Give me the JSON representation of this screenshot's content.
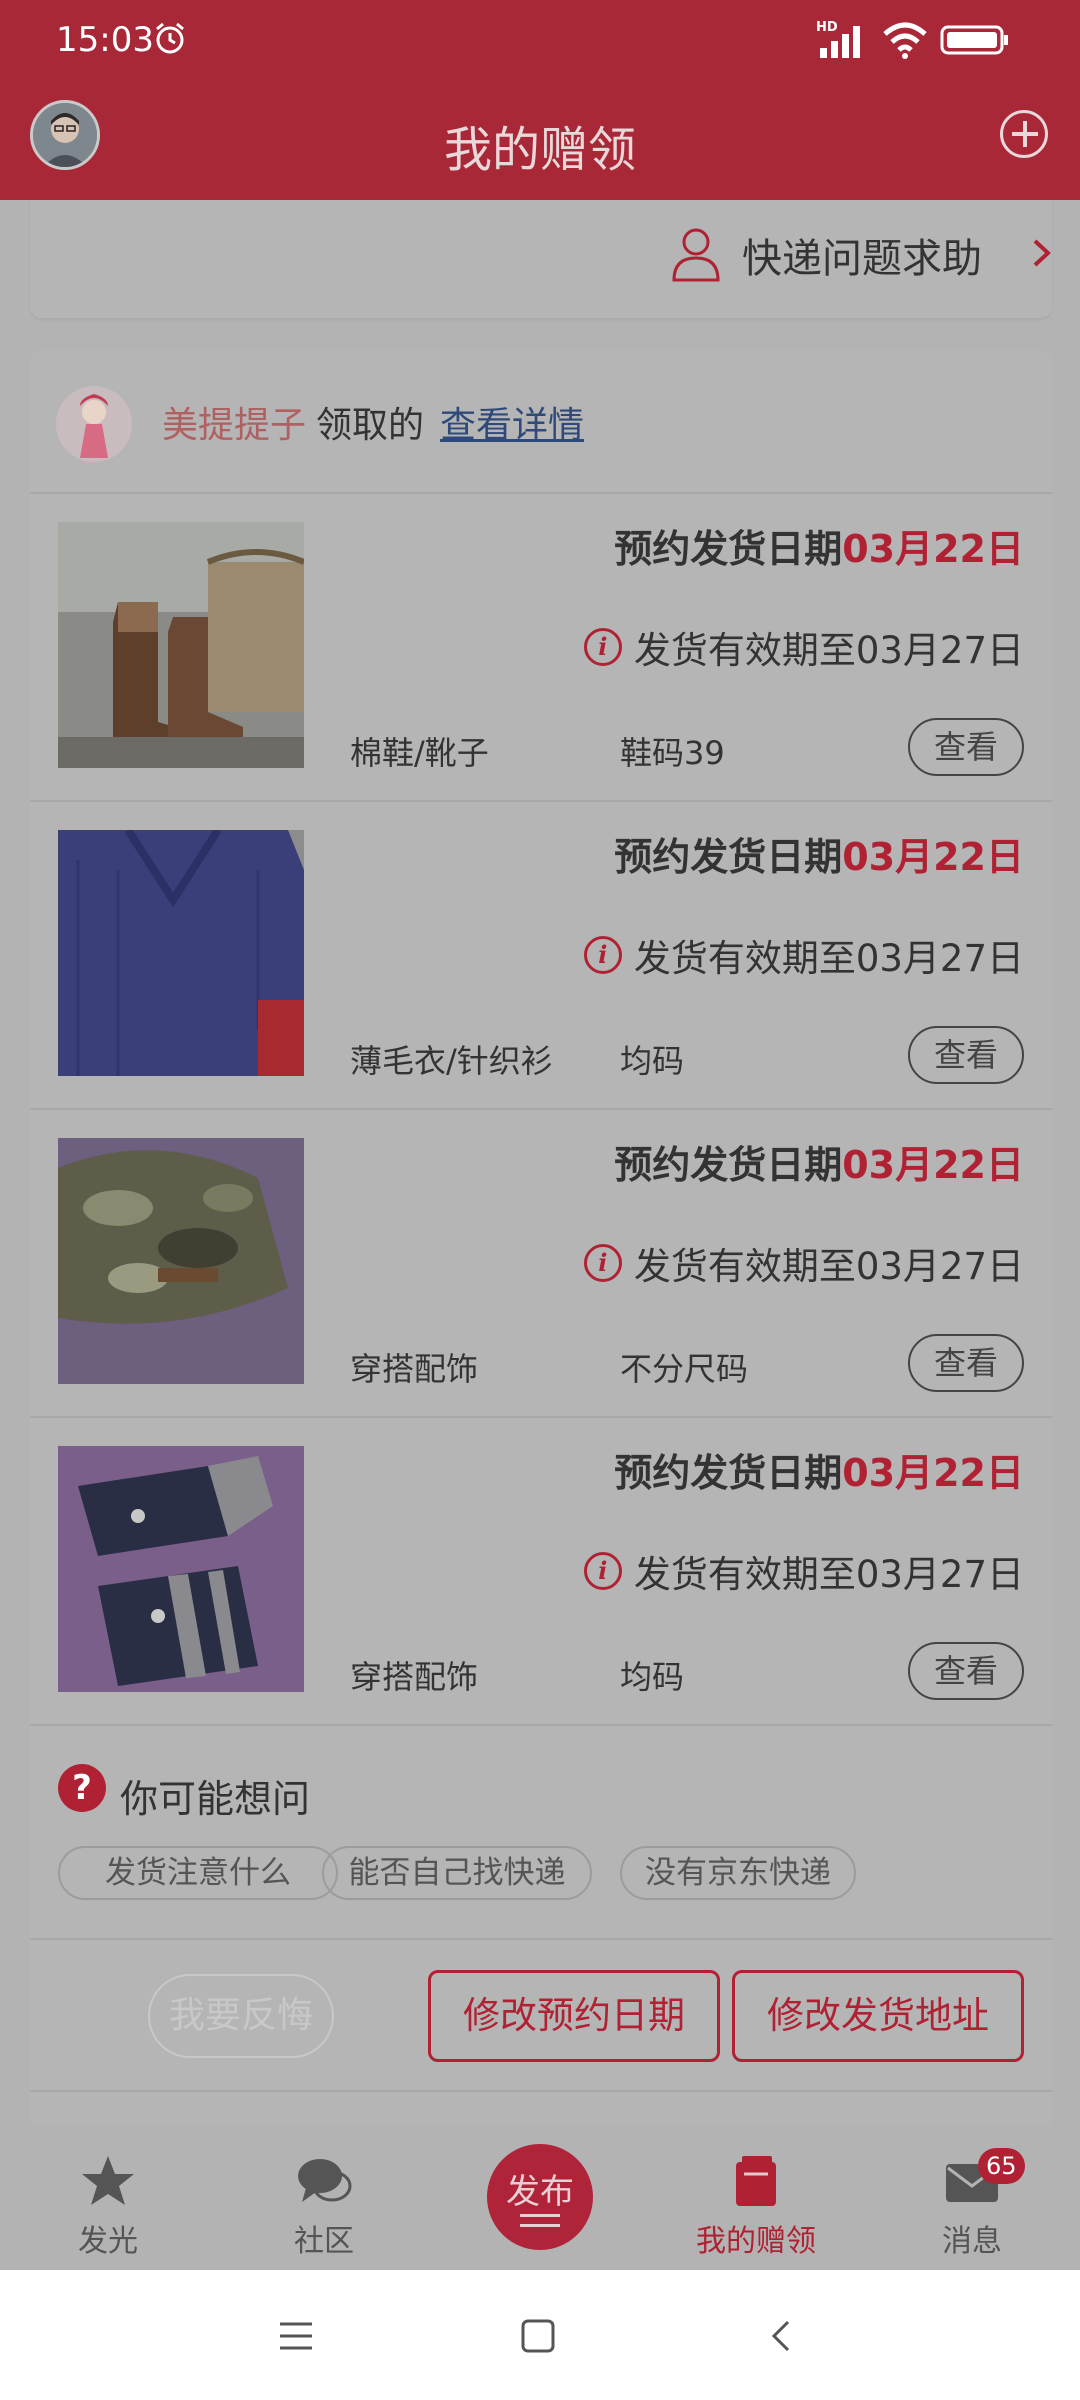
{
  "status_bar": {
    "time": "15:03",
    "hd": "HD"
  },
  "header": {
    "title": "我的赠领"
  },
  "help": {
    "label": "快递问题求助"
  },
  "order": {
    "giver_name": "美提提子",
    "middle_text": "领取的",
    "detail_link": "查看详情",
    "items": [
      {
        "ship_label": "预约发货日期",
        "ship_date": "03月22日",
        "validity": "发货有效期至03月27日",
        "category": "棉鞋/靴子",
        "size": "鞋码39",
        "view_label": "查看"
      },
      {
        "ship_label": "预约发货日期",
        "ship_date": "03月22日",
        "validity": "发货有效期至03月27日",
        "category": "薄毛衣/针织衫",
        "size": "均码",
        "view_label": "查看"
      },
      {
        "ship_label": "预约发货日期",
        "ship_date": "03月22日",
        "validity": "发货有效期至03月27日",
        "category": "穿搭配饰",
        "size": "不分尺码",
        "view_label": "查看"
      },
      {
        "ship_label": "预约发货日期",
        "ship_date": "03月22日",
        "validity": "发货有效期至03月27日",
        "category": "穿搭配饰",
        "size": "均码",
        "view_label": "查看"
      }
    ]
  },
  "faq": {
    "icon": "?",
    "title": "你可能想问",
    "chips": [
      "发货注意什么",
      "能否自己找快递",
      "没有京东快递"
    ]
  },
  "actions": {
    "regret": "我要反悔",
    "change_date": "修改预约日期",
    "change_address": "修改发货地址"
  },
  "bottom_nav": {
    "items": [
      {
        "label": "发光",
        "icon": "star-icon"
      },
      {
        "label": "社区",
        "icon": "chat-icon"
      },
      {
        "label": "发布",
        "icon": "publish-icon"
      },
      {
        "label": "我的赠领",
        "icon": "gift-box-icon"
      },
      {
        "label": "消息",
        "icon": "mail-icon",
        "badge": "65"
      }
    ]
  },
  "colors": {
    "accent": "#b02233",
    "header": "#a82837",
    "overlay": "#b3b3b3"
  }
}
